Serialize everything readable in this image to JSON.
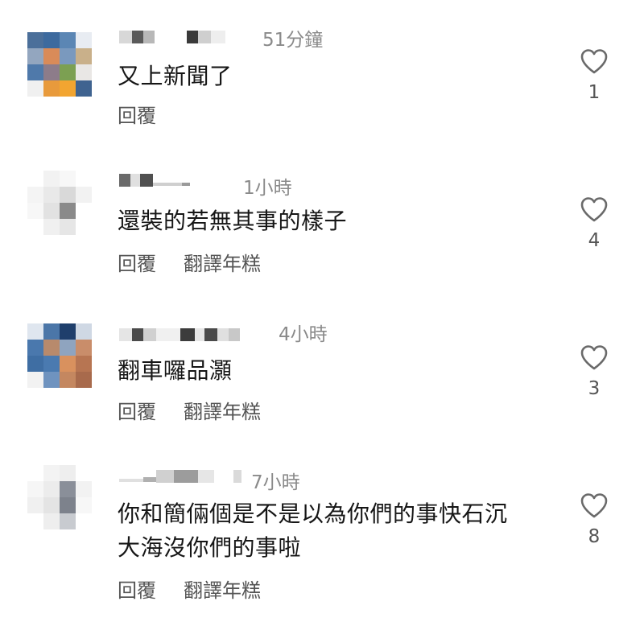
{
  "comments": [
    {
      "time": "51分鐘",
      "text": "又上新聞了",
      "actions": [
        "回覆"
      ],
      "likes": "1"
    },
    {
      "time": "1小時",
      "text": "還裝的若無其事的樣子",
      "actions": [
        "回覆",
        "翻譯年糕"
      ],
      "likes": "4"
    },
    {
      "time": "4小時",
      "text": "翻車囉品灝",
      "actions": [
        "回覆",
        "翻譯年糕"
      ],
      "likes": "3"
    },
    {
      "time": "7小時",
      "text_line1": "你和簡倆個是不是以為你們的事快石沉",
      "text_line2": "大海沒你們的事啦",
      "actions": [
        "回覆",
        "翻譯年糕"
      ],
      "likes": "8"
    }
  ]
}
